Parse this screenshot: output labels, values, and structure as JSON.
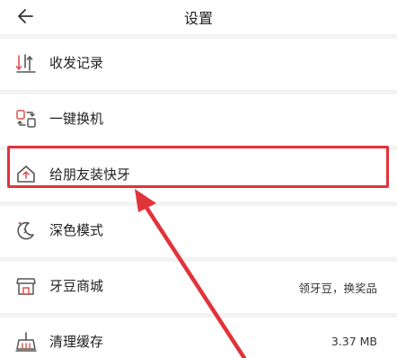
{
  "header": {
    "title": "设置",
    "back_icon": "arrow-left-icon"
  },
  "settings": {
    "items": [
      {
        "label": "收发记录",
        "icon": "transfer-record-icon",
        "value": ""
      },
      {
        "label": "一键换机",
        "icon": "phone-switch-icon",
        "value": ""
      },
      {
        "label": "给朋友装快牙",
        "icon": "home-share-icon",
        "value": ""
      },
      {
        "label": "深色模式",
        "icon": "moon-icon",
        "value": ""
      },
      {
        "label": "牙豆商城",
        "icon": "shop-icon",
        "value": "领牙豆，换奖品"
      },
      {
        "label": "清理缓存",
        "icon": "broom-icon",
        "value": "3.37 MB"
      }
    ]
  },
  "annotation": {
    "highlight_color": "#e1333a",
    "icon_color": "#d9534f"
  }
}
